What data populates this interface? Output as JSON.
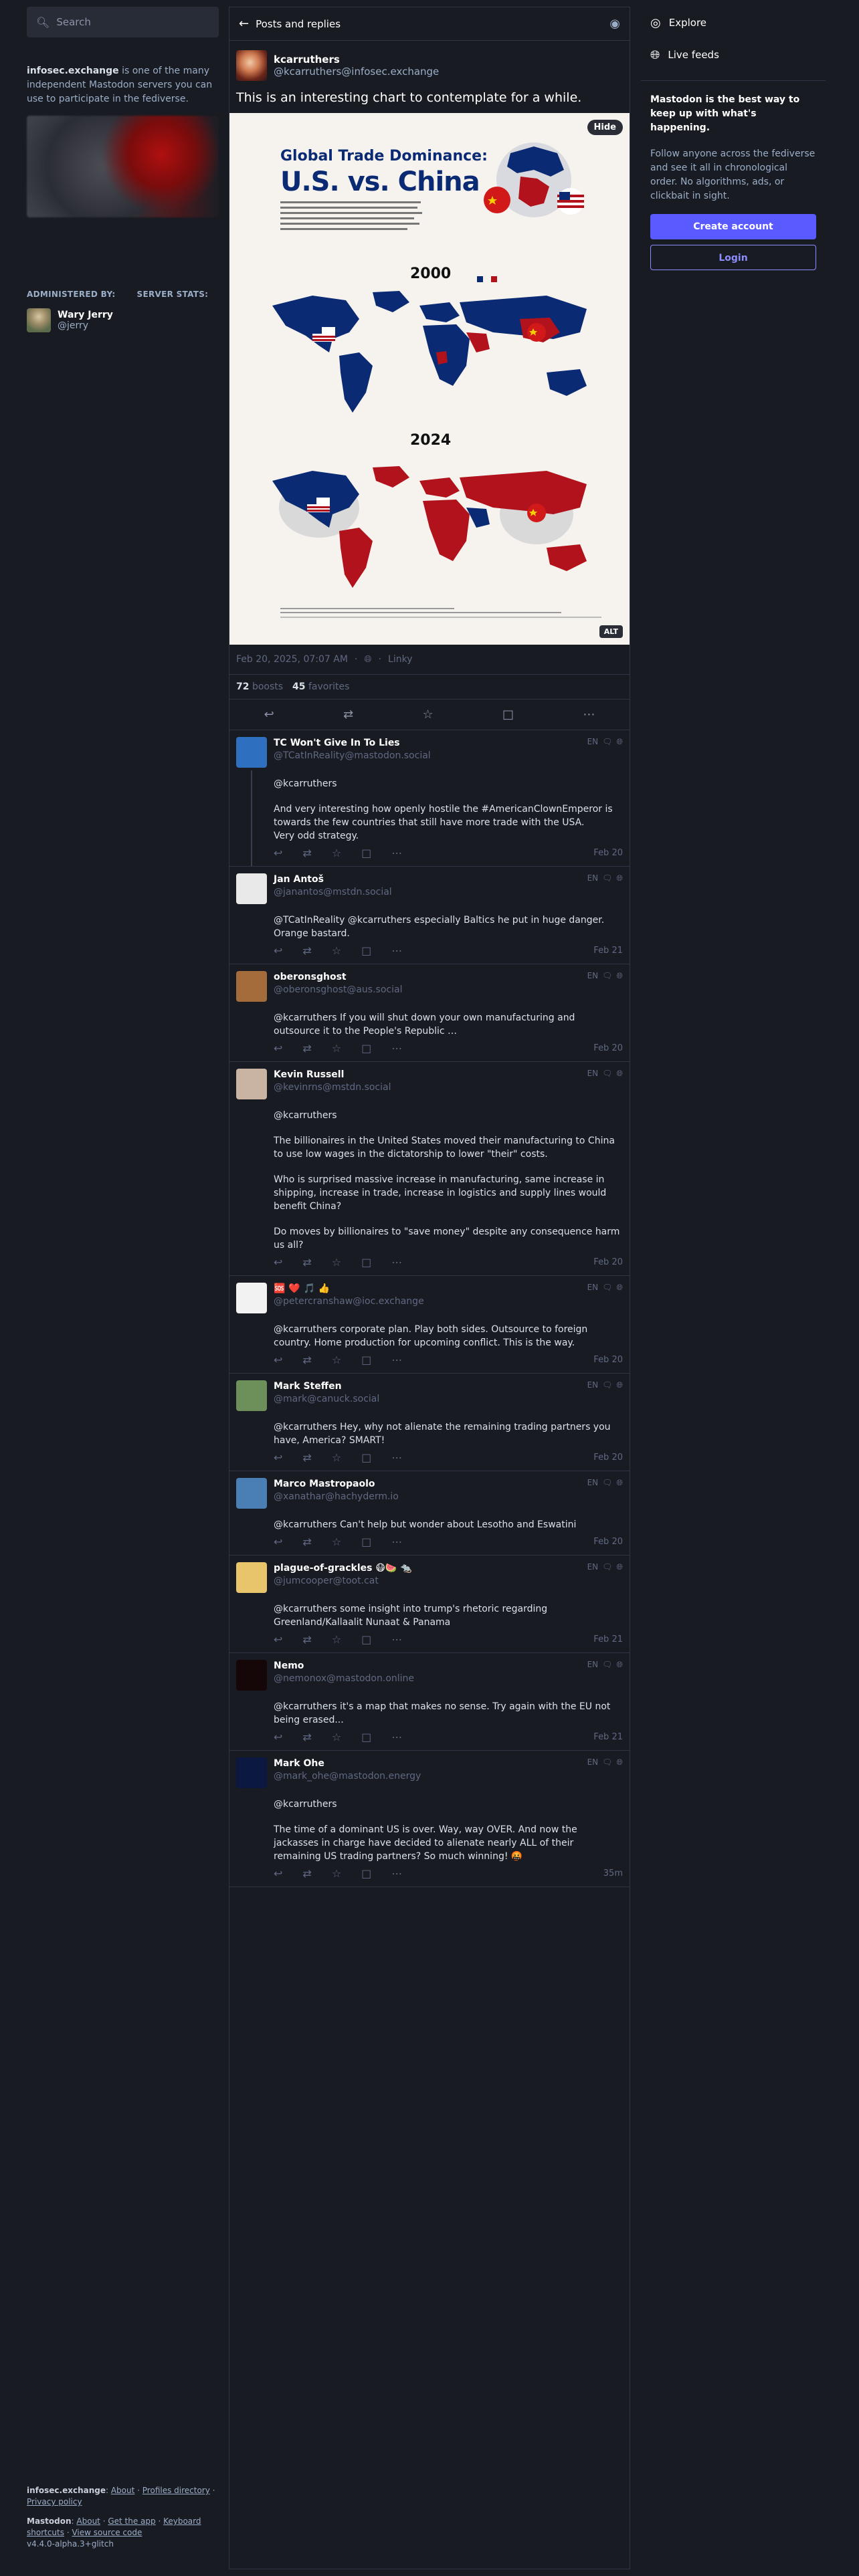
{
  "search": {
    "placeholder": "Search"
  },
  "server": {
    "name": "infosec.exchange",
    "about_rest": " is one of the many independent Mastodon servers you can use to participate in the fediverse."
  },
  "admin": {
    "administered_by_label": "ADMINISTERED BY:",
    "server_stats_label": "SERVER STATS:",
    "name": "Wary Jerry",
    "handle": "@jerry"
  },
  "left_footer": {
    "line1_server": "infosec.exchange",
    "line1_links": [
      "About",
      "Profiles directory",
      "Privacy policy"
    ],
    "line2_brand": "Mastodon",
    "line2_links": [
      "About",
      "Get the app",
      "Keyboard shortcuts",
      "View source code"
    ],
    "version": "v4.4.0-alpha.3+glitch"
  },
  "header": {
    "title": "Posts and replies"
  },
  "status": {
    "display_name": "kcarruthers",
    "acct": "@kcarruthers@infosec.exchange",
    "content": "This is an interesting chart to contemplate for a while.",
    "media": {
      "hide_label": "Hide",
      "alt_label": "ALT",
      "title_line1": "Global Trade Dominance:",
      "title_line2": "U.S. vs. China",
      "year_top": "2000",
      "year_bottom": "2024"
    },
    "timestamp": "Feb 20, 2025, 07:07 AM",
    "app": "Linky",
    "boosts_count": "72",
    "boosts_label": "boosts",
    "favorites_count": "45",
    "favorites_label": "favorites"
  },
  "replies": [
    {
      "name": "TC Won't Give In To Lies",
      "acct": "@TCatInReality@mastodon.social",
      "paragraphs": [
        "@kcarruthers",
        "And very interesting how openly hostile the #AmericanClownEmperor is towards the few countries that still have more trade with the USA.\nVery odd strategy."
      ],
      "time": "Feb 20",
      "avatar_color": "#2e6fc0"
    },
    {
      "name": "Jan Antoš",
      "acct": "@janantos@mstdn.social",
      "paragraphs": [
        "@TCatInReality @kcarruthers especially Baltics he put in huge danger. Orange bastard."
      ],
      "time": "Feb 21",
      "avatar_color": "#e9e9e9"
    },
    {
      "name": "oberonsghost",
      "acct": "@oberonsghost@aus.social",
      "paragraphs": [
        "@kcarruthers If you will shut down your own manufacturing and outsource it to the People's Republic …"
      ],
      "time": "Feb 20",
      "avatar_color": "#a46b3b"
    },
    {
      "name": "Kevin Russell",
      "acct": "@kevinrns@mstdn.social",
      "paragraphs": [
        "@kcarruthers",
        "The billionaires in the United States moved their manufacturing to China to use low wages in the dictatorship to lower \"their\" costs.",
        "Who is surprised massive increase in manufacturing, same increase in shipping, increase in trade, increase in logistics and supply lines would benefit China?",
        "Do moves by billionaires to \"save money\" despite any consequence harm us all?"
      ],
      "time": "Feb 20",
      "avatar_color": "#c9b3a3"
    },
    {
      "name": "🆘 ❤️ 🎵 👍",
      "acct": "@petercranshaw@ioc.exchange",
      "paragraphs": [
        "@kcarruthers corporate plan. Play both sides. Outsource to foreign country. Home production for upcoming conflict. This is the way."
      ],
      "time": "Feb 20",
      "avatar_color": "#f2f2f2"
    },
    {
      "name": "Mark Steffen",
      "acct": "@mark@canuck.social",
      "paragraphs": [
        "@kcarruthers Hey, why not alienate the remaining trading partners you have, America? SMART!"
      ],
      "time": "Feb 20",
      "avatar_color": "#6d8f5a"
    },
    {
      "name": "Marco Mastropaolo",
      "acct": "@xanathar@hachyderm.io",
      "paragraphs": [
        "@kcarruthers Can't help but wonder about Lesotho and Eswatini"
      ],
      "time": "Feb 20",
      "avatar_color": "#4a7fb5"
    },
    {
      "name": "plague-of-grackles 😷🍉 🐀",
      "acct": "@jumcooper@toot.cat",
      "paragraphs": [
        "@kcarruthers some insight into trump's rhetoric regarding Greenland/Kallaalit Nunaat & Panama"
      ],
      "time": "Feb 21",
      "avatar_color": "#e8c46a"
    },
    {
      "name": "Nemo",
      "acct": "@nemonox@mastodon.online",
      "paragraphs": [
        "@kcarruthers it's a map that makes no sense. Try again with the EU not being erased..."
      ],
      "time": "Feb 21",
      "avatar_color": "#150608"
    },
    {
      "name": "Mark Ohe",
      "acct": "@mark_ohe@mastodon.energy",
      "paragraphs": [
        "@kcarruthers",
        "The time of a dominant US is over. Way, way OVER.  And now the jackasses in charge have decided to alienate nearly ALL of their remaining US trading partners?  So much winning! 🤬"
      ],
      "time": "35m",
      "avatar_color": "#0b1840"
    }
  ],
  "reply_meta": {
    "lang": "EN"
  },
  "right": {
    "explore_label": "Explore",
    "live_feeds_label": "Live feeds",
    "promo_title": "Mastodon is the best way to keep up with what's happening.",
    "promo_text": "Follow anyone across the fediverse and see it all in chronological order. No algorithms, ads, or clickbait in sight.",
    "create_account_label": "Create account",
    "login_label": "Login"
  },
  "colors": {
    "accent": "#595aff",
    "background": "#191b22",
    "panel": "#282c37"
  }
}
